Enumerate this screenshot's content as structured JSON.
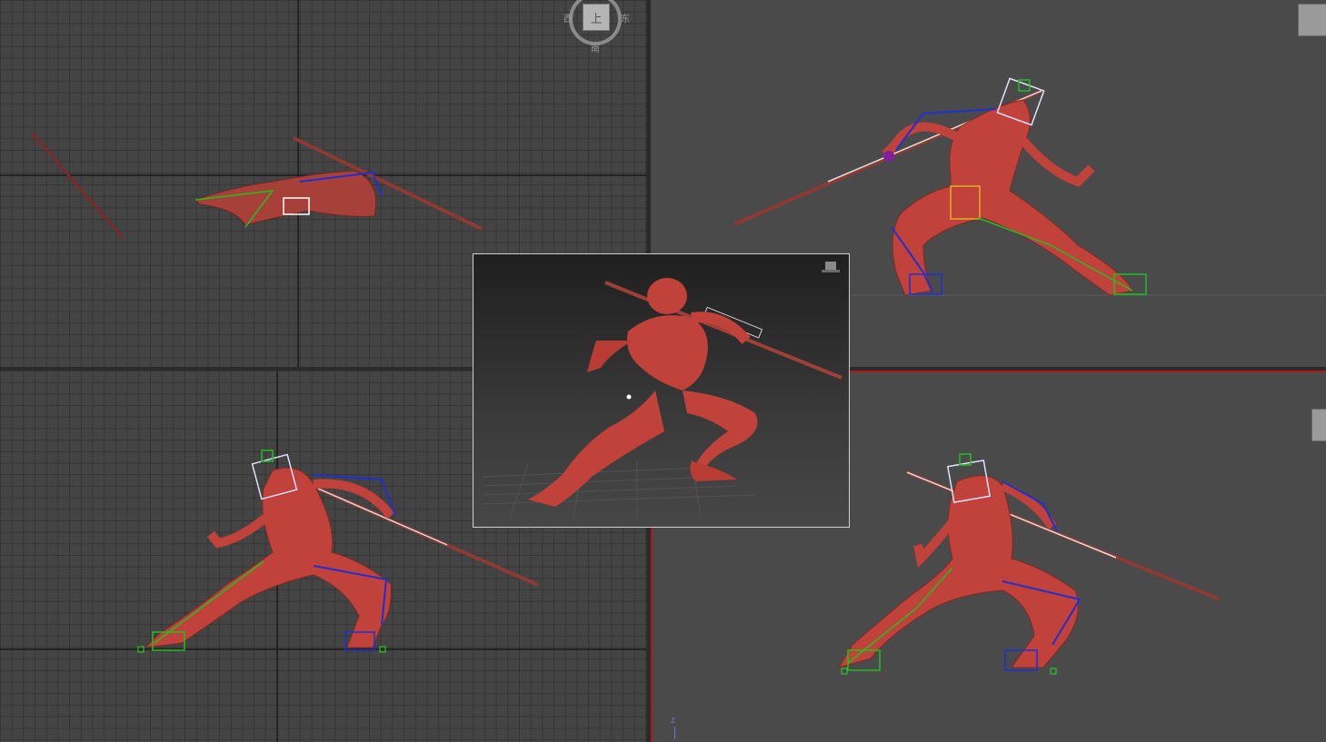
{
  "viewcube": {
    "top_face": "上",
    "west": "西",
    "east": "东",
    "south": "南"
  },
  "perspective_axis": {
    "z_label": "z"
  },
  "colors": {
    "model": "#c0423a",
    "grid_bg": "#444444",
    "active_border": "#b01818",
    "bone_blue": "#2030d0",
    "bone_green": "#20c020",
    "bone_white": "#e0e0ff"
  },
  "viewports": [
    {
      "id": "top",
      "kind": "orthographic-grid"
    },
    {
      "id": "left",
      "kind": "perspective-shaded"
    },
    {
      "id": "front",
      "kind": "orthographic-grid"
    },
    {
      "id": "perspective",
      "kind": "perspective-shaded",
      "active": true
    }
  ],
  "floating_window": {
    "kind": "rendered-preview"
  }
}
